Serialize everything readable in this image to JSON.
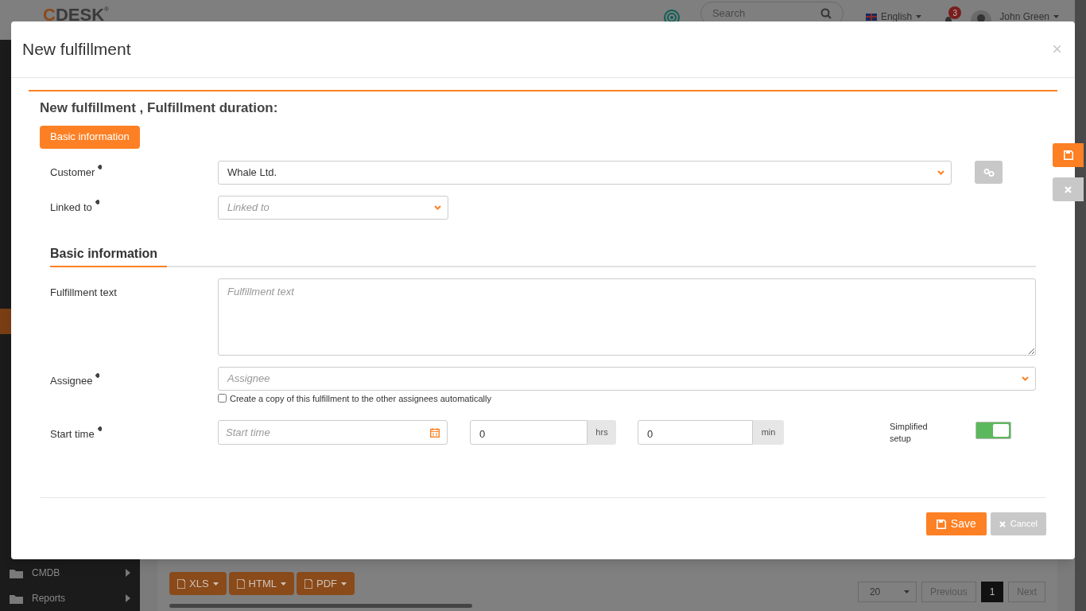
{
  "background": {
    "logo": {
      "first_letter": "C",
      "rest": "DESK",
      "mark": "®"
    },
    "search_placeholder": "Search",
    "language": "English",
    "notifications": "3",
    "user": "John Green",
    "sidebar_items": [
      {
        "label": "CMDB",
        "selected": false
      },
      {
        "label": "Reports",
        "selected": false
      }
    ],
    "export_buttons": [
      "XLS",
      "HTML",
      "PDF"
    ],
    "page_size": "20",
    "pagination": [
      {
        "label": "Previous",
        "selected": false
      },
      {
        "label": "1",
        "selected": true
      },
      {
        "label": "Next",
        "selected": false
      }
    ]
  },
  "dialog": {
    "title": "New fulfillment",
    "close": "×",
    "heading": "New fulfillment , Fulfillment duration:",
    "tab": "Basic information",
    "customer": {
      "label": "Customer",
      "required": true,
      "value": "Whale Ltd."
    },
    "linked_to": {
      "label": "Linked to",
      "required": true,
      "placeholder": "Linked to"
    },
    "section": "Basic information",
    "fulfillment_text": {
      "label": "Fulfillment text",
      "required": false,
      "placeholder": "Fulfillment text"
    },
    "assignee": {
      "label": "Assignee",
      "required": true,
      "placeholder": "Assignee",
      "copy_checkbox": {
        "label": "Create a copy of this fulfillment to the other assignees automatically",
        "checked": false
      }
    },
    "start_time": {
      "label": "Start time",
      "required": true,
      "placeholder": "Start time",
      "hours": "0",
      "hours_unit": "hrs",
      "minutes": "0",
      "minutes_unit": "min"
    },
    "simplified_setup": {
      "label": "Simplified setup",
      "on": true
    },
    "buttons": [
      {
        "kind": "save",
        "label": "Save"
      },
      {
        "kind": "cancel",
        "label": "Cancel"
      }
    ]
  }
}
